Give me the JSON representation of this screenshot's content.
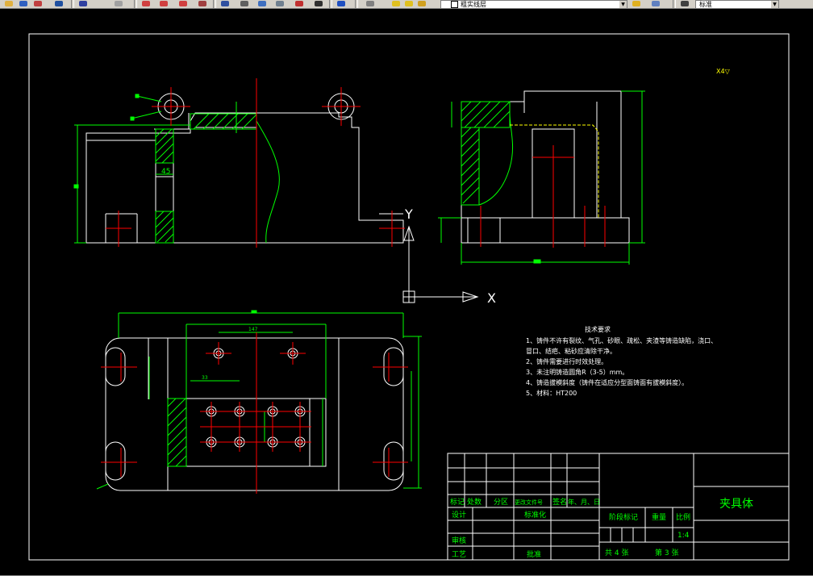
{
  "toolbar": {
    "layer_name": "粗实线层",
    "style_name": "标准",
    "buttons": [
      "open-icon",
      "save-icon",
      "undo-icon",
      "redo-icon",
      "pan-icon",
      "zoom-realtime-icon",
      "zoom-window-icon",
      "zoom-previous-icon",
      "properties-icon",
      "text-style-icon",
      "layer-manager-icon",
      "table-icon",
      "help-icon"
    ]
  },
  "drawing": {
    "scale_note": "X4▽",
    "ucs_x_label": "X",
    "ucs_y_label": "Y",
    "dim_front_width": "45",
    "dim_top_center": "147",
    "dim_top_small": "33",
    "tech_requirements": {
      "title": "技术要求",
      "lines": [
        "1、铸件不许有裂纹、气孔、砂眼、疏松、夹渣等铸造缺陷，浇口、",
        "冒口、结疤、粘砂应清除干净。",
        "2、铸件需要进行时效处理。",
        "3、未注明铸造圆角R（3-5）mm。",
        "4、铸造拔模斜度（铸件在适应分型面铸面有拔模斜度）。",
        "5、材料：HT200"
      ]
    }
  },
  "title_block": {
    "part_name": "夹具体",
    "headers": [
      "标记",
      "处数",
      "分区",
      "更改文件号",
      "签名",
      "年、月、日"
    ],
    "row_design": "设计",
    "row_standard": "标准化",
    "row_review": "审核",
    "row_process": "工艺",
    "row_approve": "批准",
    "stage_mark": "阶段标记",
    "weight": "重量",
    "scale_label": "比例",
    "scale_value": "1:4",
    "sheets_total": "共  4  张",
    "sheet_current": "第  3  张"
  }
}
